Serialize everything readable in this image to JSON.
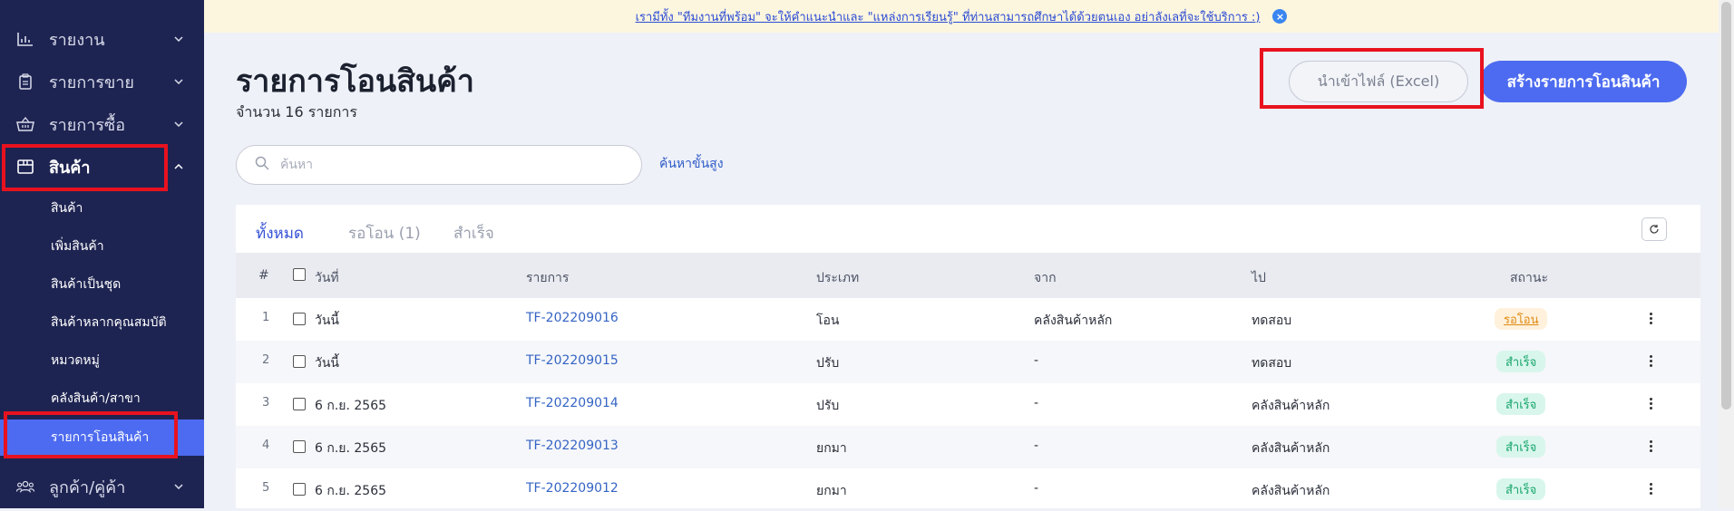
{
  "sidebar": {
    "items": [
      {
        "label": "รายงาน",
        "icon": "bar-chart-icon"
      },
      {
        "label": "รายการขาย",
        "icon": "clipboard-icon"
      },
      {
        "label": "รายการซื้อ",
        "icon": "basket-icon"
      },
      {
        "label": "สินค้า",
        "icon": "box-icon"
      },
      {
        "label": "ลูกค้า/คู่ค้า",
        "icon": "users-icon"
      }
    ],
    "sub_items": [
      {
        "label": "สินค้า"
      },
      {
        "label": "เพิ่มสินค้า"
      },
      {
        "label": "สินค้าเป็นชุด"
      },
      {
        "label": "สินค้าหลากคุณสมบัติ"
      },
      {
        "label": "หมวดหมู่"
      },
      {
        "label": "คลังสินค้า/สาขา"
      },
      {
        "label": "รายการโอนสินค้า"
      }
    ]
  },
  "banner": {
    "text": "เรามีทั้ง \"ทีมงานที่พร้อม\" จะให้คำแนะนำและ \"แหล่งการเรียนรู้\" ที่ท่านสามารถศึกษาได้ด้วยตนเอง อย่าลังเลที่จะใช้บริการ :)",
    "close": "×"
  },
  "page": {
    "title": "รายการโอนสินค้า",
    "count": "จำนวน 16 รายการ",
    "import_button": "นำเข้าไฟล์ (Excel)",
    "create_button": "สร้างรายการโอนสินค้า"
  },
  "search": {
    "placeholder": "ค้นหา",
    "advanced": "ค้นหาขั้นสูง"
  },
  "tabs": [
    {
      "label": "ทั้งหมด"
    },
    {
      "label": "รอโอน (1)"
    },
    {
      "label": "สำเร็จ"
    }
  ],
  "table": {
    "headers": {
      "index": "#",
      "date": "วันที่",
      "doc": "รายการ",
      "type": "ประเภท",
      "from": "จาก",
      "to": "ไป",
      "status": "สถานะ"
    },
    "rows": [
      {
        "index": "1",
        "date": "วันนี้",
        "doc": "TF-202209016",
        "type": "โอน",
        "from": "คลังสินค้าหลัก",
        "to": "ทดสอบ",
        "status": "รอโอน",
        "status_kind": "pending"
      },
      {
        "index": "2",
        "date": "วันนี้",
        "doc": "TF-202209015",
        "type": "ปรับ",
        "from": "-",
        "to": "ทดสอบ",
        "status": "สำเร็จ",
        "status_kind": "done"
      },
      {
        "index": "3",
        "date": "6 ก.ย. 2565",
        "doc": "TF-202209014",
        "type": "ปรับ",
        "from": "-",
        "to": "คลังสินค้าหลัก",
        "status": "สำเร็จ",
        "status_kind": "done"
      },
      {
        "index": "4",
        "date": "6 ก.ย. 2565",
        "doc": "TF-202209013",
        "type": "ยกมา",
        "from": "-",
        "to": "คลังสินค้าหลัก",
        "status": "สำเร็จ",
        "status_kind": "done"
      },
      {
        "index": "5",
        "date": "6 ก.ย. 2565",
        "doc": "TF-202209012",
        "type": "ยกมา",
        "from": "-",
        "to": "คลังสินค้าหลัก",
        "status": "สำเร็จ",
        "status_kind": "done"
      }
    ]
  },
  "colors": {
    "sidebar_bg": "#1e2452",
    "accent": "#4d6bf0",
    "highlight": "#e8121f",
    "pending": "#e08a12",
    "done": "#16a56c"
  }
}
